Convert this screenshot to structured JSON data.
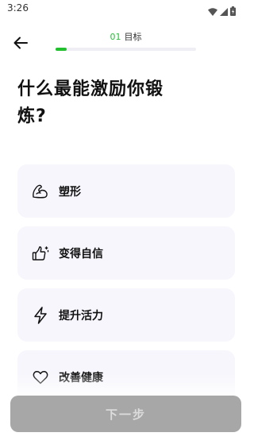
{
  "status_bar": {
    "time": "3:26",
    "icons": [
      "wifi-icon",
      "signal-icon",
      "battery-icon"
    ]
  },
  "header": {
    "back_icon": "arrow-left-icon",
    "step_number": "01",
    "step_title": "目标",
    "progress_fraction": 0.08
  },
  "question": "什么最能激励你锻炼?",
  "options": [
    {
      "icon": "flexed-arm-icon",
      "label": "塑形"
    },
    {
      "icon": "thumbs-up-sparkle-icon",
      "label": "变得自信"
    },
    {
      "icon": "lightning-icon",
      "label": "提升活力"
    },
    {
      "icon": "heart-icon",
      "label": "改善健康"
    }
  ],
  "next_button": {
    "label": "下一步",
    "state": "disabled"
  },
  "colors": {
    "accent": "#22c02e",
    "step_number": "#2bbf3a",
    "card_bg": "#f6f6fc",
    "button_disabled_bg": "#a7a7a7",
    "button_disabled_text": "#dcdcdc"
  }
}
